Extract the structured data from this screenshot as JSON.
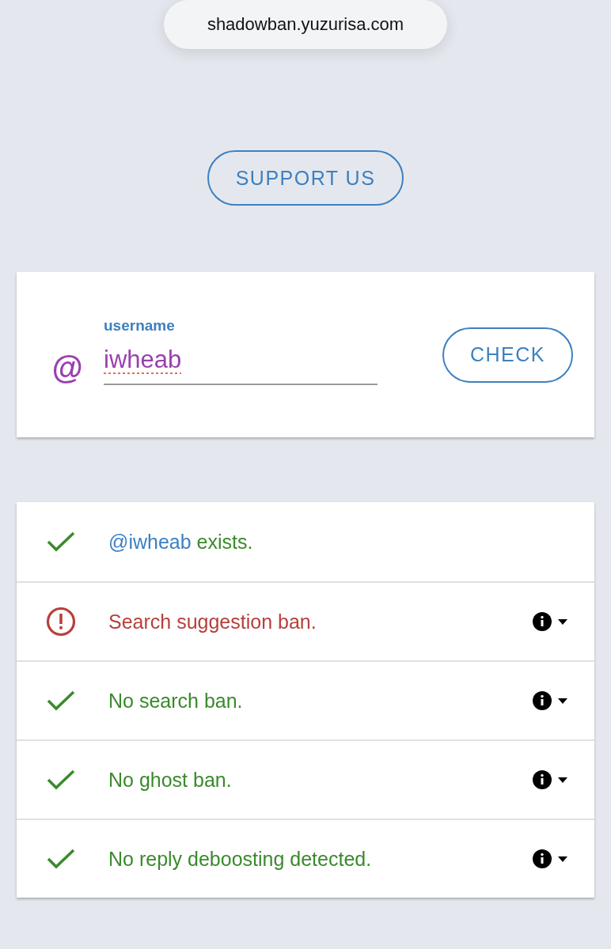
{
  "address_bar": {
    "url": "shadowban.yuzurisa.com"
  },
  "support_button": "SUPPORT US",
  "form": {
    "prefix": "@",
    "label": "username",
    "value": "iwheab",
    "spellcheck_flagged": true,
    "button": "CHECK"
  },
  "results": [
    {
      "kind": "ok",
      "user": "@iwheab",
      "text": "exists.",
      "expandable": false
    },
    {
      "kind": "ban",
      "text": "Search suggestion ban.",
      "expandable": true
    },
    {
      "kind": "ok",
      "text": "No search ban.",
      "expandable": true
    },
    {
      "kind": "ok",
      "text": "No ghost ban.",
      "expandable": true
    },
    {
      "kind": "ok",
      "text": "No reply deboosting detected.",
      "expandable": true
    }
  ]
}
